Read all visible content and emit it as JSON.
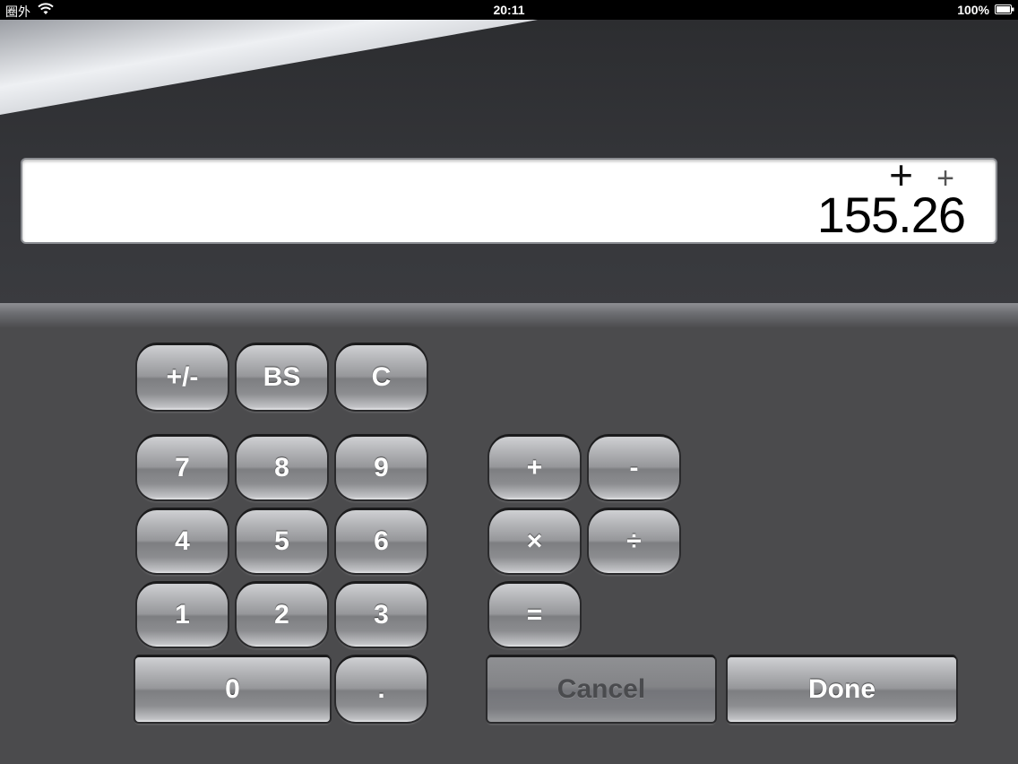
{
  "status_bar": {
    "carrier": "圈外",
    "time": "20:11",
    "battery_percent": "100%"
  },
  "display": {
    "operator_main": "+",
    "operator_pending": "+",
    "value": "155.26"
  },
  "keys": {
    "plus_minus": "+/-",
    "backspace": "BS",
    "clear": "C",
    "seven": "7",
    "eight": "8",
    "nine": "9",
    "four": "4",
    "five": "5",
    "six": "6",
    "one": "1",
    "two": "2",
    "three": "3",
    "zero": "0",
    "decimal": ".",
    "add": "+",
    "subtract": "-",
    "multiply": "×",
    "divide": "÷",
    "equals": "=",
    "cancel": "Cancel",
    "done": "Done"
  },
  "icons": {
    "wifi": "wifi-icon",
    "battery": "battery-icon"
  },
  "colors": {
    "display_bg": "#ffffff",
    "panel_bg": "#4b4b4d",
    "key_text": "#ffffff",
    "cancel_text": "#4a4b4e"
  }
}
